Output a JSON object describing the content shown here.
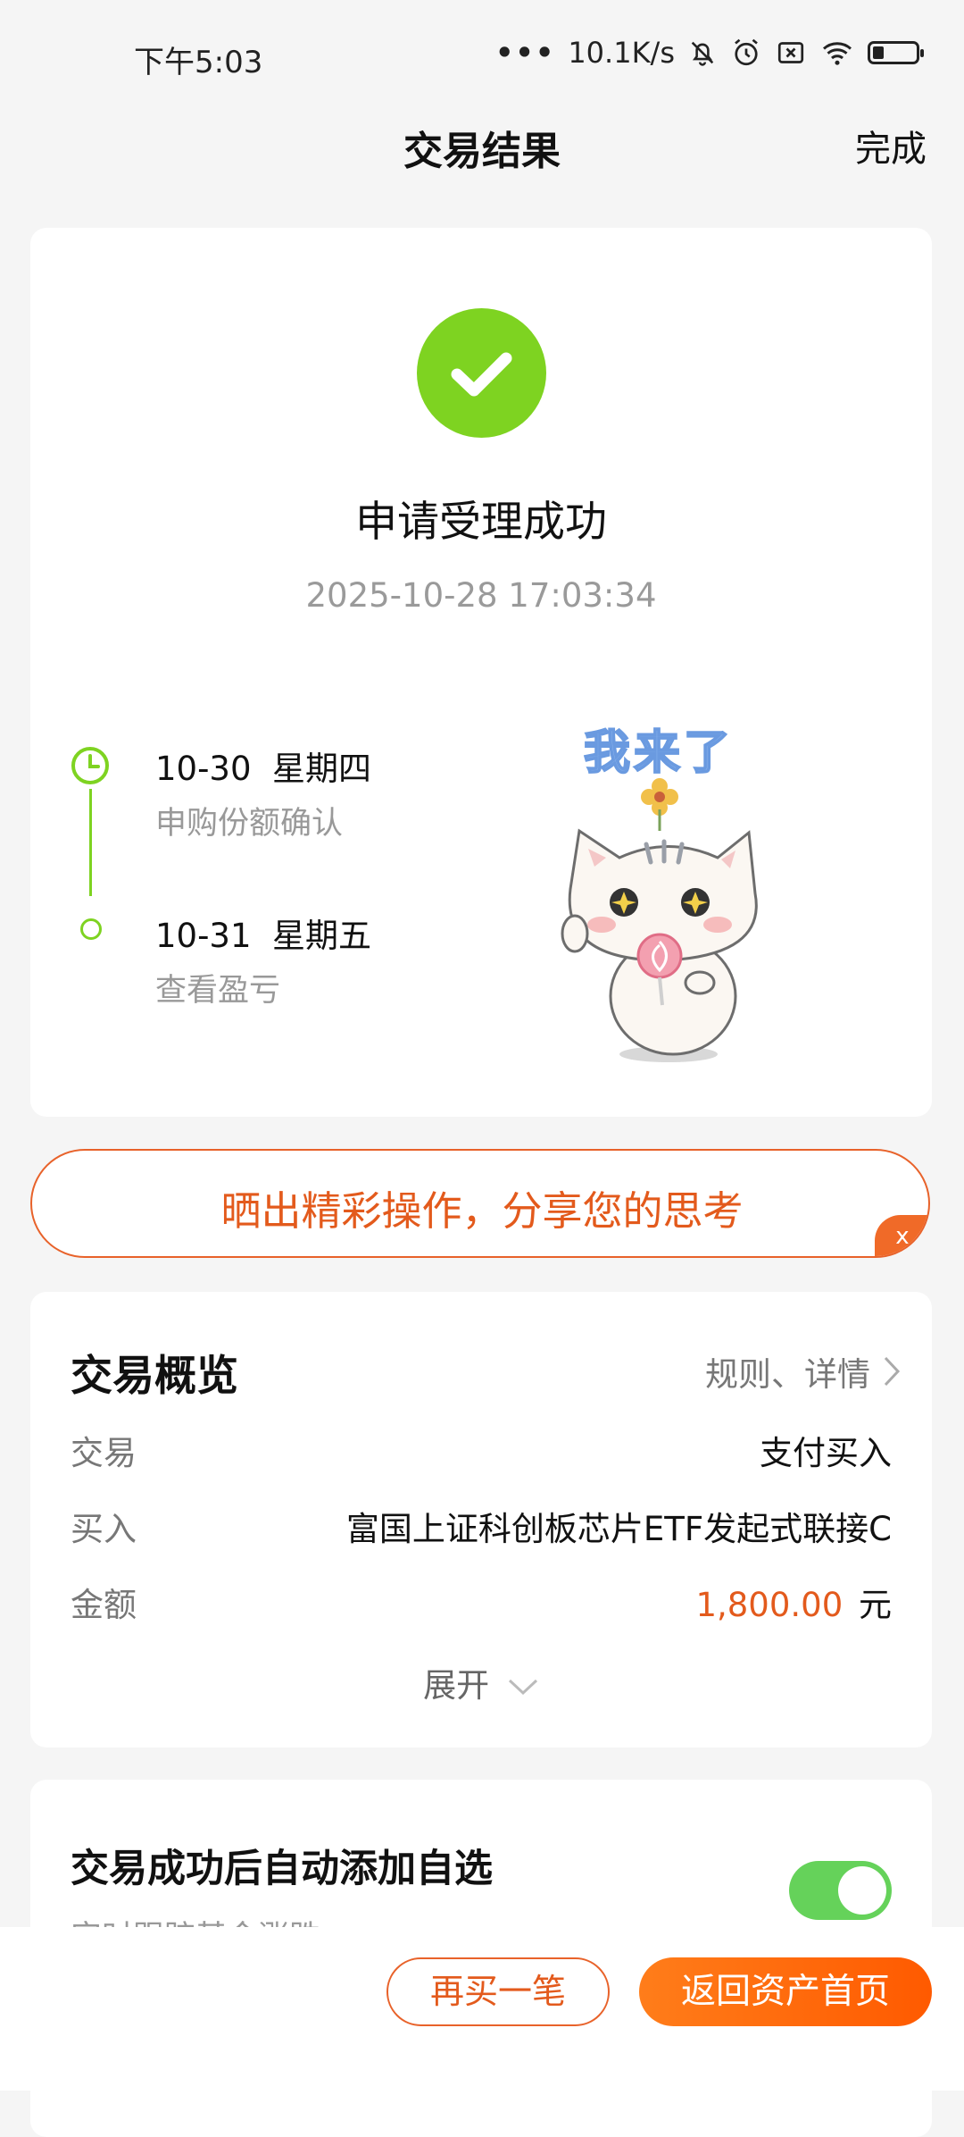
{
  "status_bar": {
    "time": "下午5:03",
    "dots": "•••",
    "network_speed": "10.1K/s",
    "icons": [
      "bell-muted-icon",
      "alarm-icon",
      "sim-none-icon",
      "wifi-icon",
      "battery-icon"
    ]
  },
  "header": {
    "title": "交易结果",
    "done_label": "完成"
  },
  "result": {
    "status_icon": "check-icon",
    "accent_color": "#7ed321",
    "title": "申请受理成功",
    "timestamp": "2025-10-28 17:03:34",
    "timeline": [
      {
        "date": "10-30  星期四",
        "desc": "申购份额确认",
        "icon": "clock-icon"
      },
      {
        "date": "10-31  星期五",
        "desc": "查看盈亏",
        "icon": "dot-icon"
      }
    ],
    "sticker": {
      "text": "我来了",
      "icon": "cat-sticker-icon"
    }
  },
  "share_banner": {
    "text": "晒出精彩操作，分享您的思考",
    "close_label": "x"
  },
  "overview": {
    "title": "交易概览",
    "link_label": "规则、详情",
    "rows": [
      {
        "label": "交易",
        "value": "支付买入"
      },
      {
        "label": "买入",
        "value": "富国上证科创板芯片ETF发起式联接C"
      },
      {
        "label": "金额",
        "value": "1,800.00",
        "unit": "元"
      }
    ],
    "expand_label": "展开"
  },
  "auto_watch": {
    "title": "交易成功后自动添加自选",
    "subtitle": "实时跟踪基金涨跌",
    "toggle_on": true,
    "toggle_color": "#65d25a"
  },
  "actions": {
    "buy_again_label": "再买一笔",
    "home_label": "返回资产首页",
    "brand_color": "#ff6a00"
  }
}
